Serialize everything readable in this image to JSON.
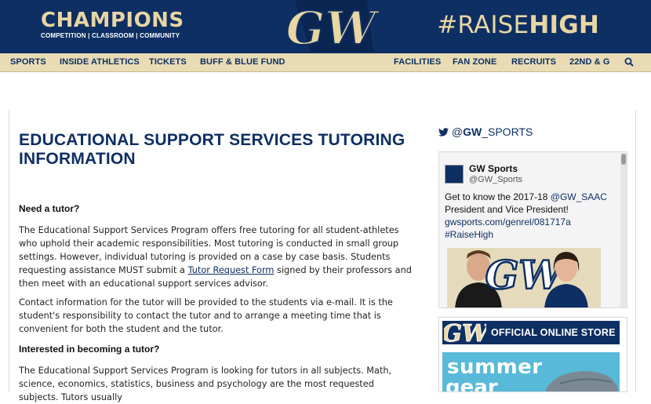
{
  "header": {
    "champions_title": "CHAMPIONS",
    "champions_sub": "COMPETITION | CLASSROOM | COMMUNITY",
    "raise_part1": "#RAISE",
    "raise_part2": "HIGH",
    "logo_text": "GW"
  },
  "nav": {
    "items": [
      "SPORTS",
      "INSIDE ATHLETICS",
      "TICKETS",
      "BUFF & BLUE FUND",
      "FACILITIES",
      "FAN ZONE",
      "RECRUITS",
      "22ND & G"
    ],
    "search_icon": "search-icon"
  },
  "main": {
    "title": "EDUCATIONAL SUPPORT SERVICES TUTORING INFORMATION",
    "h_need": "Need a tutor?",
    "p1_before": "The Educational Support Services Program offers free tutoring for all student-athletes who uphold their academic responsibilities. Most tutoring is conducted in small group settings. However, individual tutoring is provided on a case by case basis. Students requesting assistance MUST submit a ",
    "p1_link": "Tutor Request Form",
    "p1_after": " signed by their professors and then meet with an educational support services advisor.",
    "p2": "Contact information for the tutor will be provided to the students via e-mail. It is the student's responsibility to contact the tutor and to arrange a meeting time that is convenient for both the student and the tutor.",
    "h_become": "Interested in becoming a tutor?",
    "p3": "The Educational Support Services Program is looking for tutors in all subjects. Math, science, economics, statistics, business and psychology are the most requested subjects. Tutors usually"
  },
  "twitter": {
    "handle_at": "@",
    "handle_bold": "GW",
    "handle_rest": "_SPORTS",
    "name": "GW Sports",
    "user": "@GW_Sports",
    "text_1": "Get to know the 2017-18 ",
    "text_mention": "@GW_SAAC",
    "text_2": " President and Vice President! ",
    "text_link": "gwsports.com/genrel/081717a",
    "text_tag": "#RaiseHigh",
    "image_logo": "GW"
  },
  "store": {
    "label": "OFFICIAL ONLINE STORE",
    "logo_text": "GW",
    "promo_word1": "summer",
    "promo_word2": "gear"
  },
  "colors": {
    "navy": "#0e2f63",
    "gold": "#e8d6a3",
    "nav_bg": "#e9dcb5",
    "promo_blue": "#58b9d8"
  }
}
